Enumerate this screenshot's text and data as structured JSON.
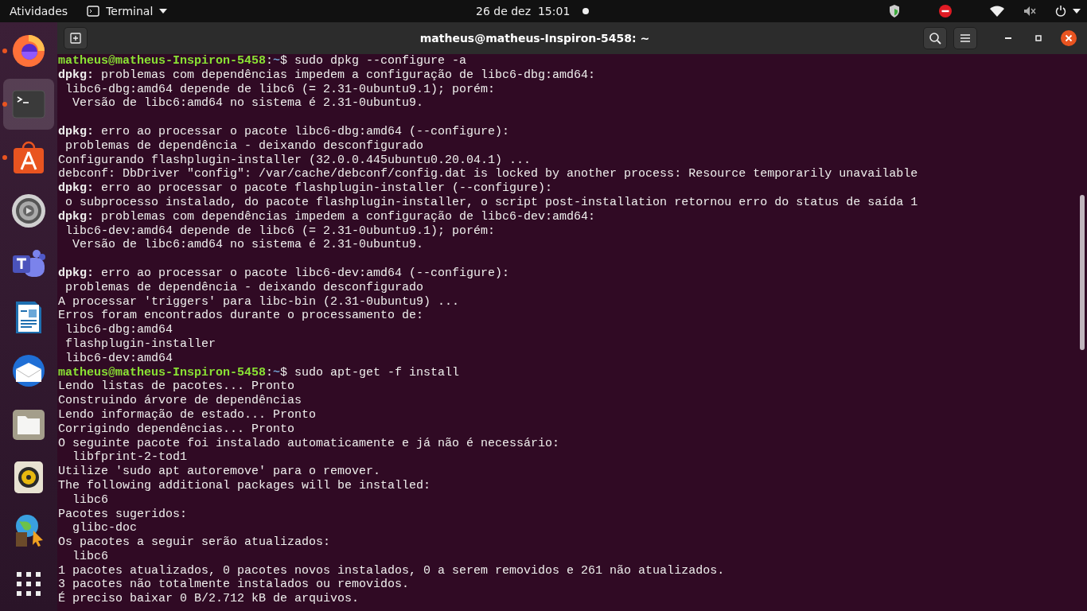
{
  "top_bar": {
    "activities": "Atividades",
    "app_menu": "Terminal",
    "date": "26 de dez",
    "time": "15:01",
    "notification_dot": true
  },
  "dock": {
    "items": [
      {
        "running": true,
        "selected": false
      },
      {
        "running": true,
        "selected": true
      },
      {
        "running": true,
        "selected": false
      },
      {
        "running": false,
        "selected": false
      },
      {
        "running": false,
        "selected": false
      },
      {
        "running": false,
        "selected": false
      },
      {
        "running": false,
        "selected": false
      },
      {
        "running": false,
        "selected": false
      },
      {
        "running": false,
        "selected": false
      },
      {
        "running": false,
        "selected": false
      }
    ]
  },
  "window": {
    "title": "matheus@matheus-Inspiron-5458: ~"
  },
  "terminal": {
    "lines": [
      {
        "kind": "prompt",
        "host": "matheus@matheus-Inspiron-5458",
        "colon": ":",
        "path": "~",
        "sign": "$",
        "command": " sudo dpkg --configure -a"
      },
      {
        "kind": "text",
        "text": "**dpkg:** problemas com dependências impedem a configuração de libc6-dbg:amd64:"
      },
      {
        "kind": "text",
        "text": " libc6-dbg:amd64 depende de libc6 (= 2.31-0ubuntu9.1); porém:"
      },
      {
        "kind": "text",
        "text": "  Versão de libc6:amd64 no sistema é 2.31-0ubuntu9."
      },
      {
        "kind": "blank"
      },
      {
        "kind": "text",
        "text": "**dpkg:** erro ao processar o pacote libc6-dbg:amd64 (--configure):"
      },
      {
        "kind": "text",
        "text": " problemas de dependência - deixando desconfigurado"
      },
      {
        "kind": "text",
        "text": "Configurando flashplugin-installer (32.0.0.445ubuntu0.20.04.1) ..."
      },
      {
        "kind": "text",
        "text": "debconf: DbDriver \"config\": /var/cache/debconf/config.dat is locked by another process: Resource temporarily unavailable"
      },
      {
        "kind": "text",
        "text": "**dpkg:** erro ao processar o pacote flashplugin-installer (--configure):"
      },
      {
        "kind": "text",
        "text": " o subprocesso instalado, do pacote flashplugin-installer, o script post-installation retornou erro do status de saída 1"
      },
      {
        "kind": "text",
        "text": "**dpkg:** problemas com dependências impedem a configuração de libc6-dev:amd64:"
      },
      {
        "kind": "text",
        "text": " libc6-dev:amd64 depende de libc6 (= 2.31-0ubuntu9.1); porém:"
      },
      {
        "kind": "text",
        "text": "  Versão de libc6:amd64 no sistema é 2.31-0ubuntu9."
      },
      {
        "kind": "blank"
      },
      {
        "kind": "text",
        "text": "**dpkg:** erro ao processar o pacote libc6-dev:amd64 (--configure):"
      },
      {
        "kind": "text",
        "text": " problemas de dependência - deixando desconfigurado"
      },
      {
        "kind": "text",
        "text": "A processar 'triggers' para libc-bin (2.31-0ubuntu9) ..."
      },
      {
        "kind": "text",
        "text": "Erros foram encontrados durante o processamento de:"
      },
      {
        "kind": "text",
        "text": " libc6-dbg:amd64"
      },
      {
        "kind": "text",
        "text": " flashplugin-installer"
      },
      {
        "kind": "text",
        "text": " libc6-dev:amd64"
      },
      {
        "kind": "prompt",
        "host": "matheus@matheus-Inspiron-5458",
        "colon": ":",
        "path": "~",
        "sign": "$",
        "command": " sudo apt-get -f install"
      },
      {
        "kind": "text",
        "text": "Lendo listas de pacotes... Pronto"
      },
      {
        "kind": "text",
        "text": "Construindo árvore de dependências"
      },
      {
        "kind": "text",
        "text": "Lendo informação de estado... Pronto"
      },
      {
        "kind": "text",
        "text": "Corrigindo dependências... Pronto"
      },
      {
        "kind": "text",
        "text": "O seguinte pacote foi instalado automaticamente e já não é necessário:"
      },
      {
        "kind": "text",
        "text": "  libfprint-2-tod1"
      },
      {
        "kind": "text",
        "text": "Utilize 'sudo apt autoremove' para o remover."
      },
      {
        "kind": "text",
        "text": "The following additional packages will be installed:"
      },
      {
        "kind": "text",
        "text": "  libc6"
      },
      {
        "kind": "text",
        "text": "Pacotes sugeridos:"
      },
      {
        "kind": "text",
        "text": "  glibc-doc"
      },
      {
        "kind": "text",
        "text": "Os pacotes a seguir serão atualizados:"
      },
      {
        "kind": "text",
        "text": "  libc6"
      },
      {
        "kind": "text",
        "text": "1 pacotes atualizados, 0 pacotes novos instalados, 0 a serem removidos e 261 não atualizados."
      },
      {
        "kind": "text",
        "text": "3 pacotes não totalmente instalados ou removidos."
      },
      {
        "kind": "text",
        "text": "É preciso baixar 0 B/2.712 kB de arquivos."
      }
    ]
  }
}
